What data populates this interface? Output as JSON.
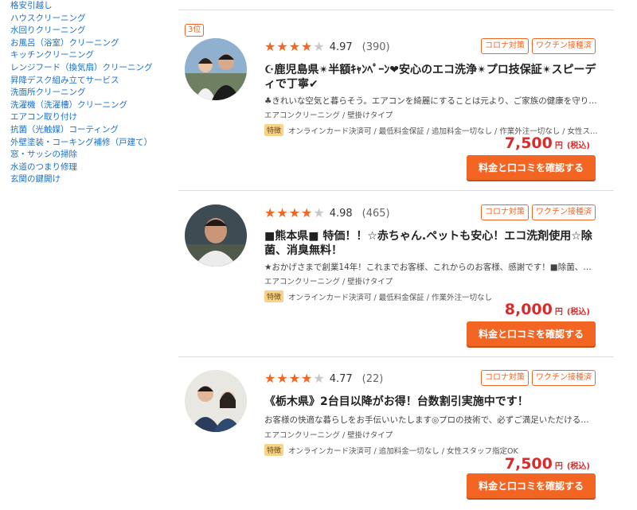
{
  "sidebar": {
    "links": [
      "格安引越し",
      "ハウスクリーニング",
      "水回りクリーニング",
      "お風呂（浴室）クリーニング",
      "キッチンクリーニング",
      "レンジフード（換気扇）クリーニング",
      "昇降デスク組み立てサービス",
      "洗面所クリーニング",
      "洗濯機（洗濯槽）クリーニング",
      "エアコン取り付け",
      "抗菌（光触媒）コーティング",
      "外壁塗装・コーキング補修（戸建て）",
      "窓・サッシの掃除",
      "水道のつまり修理",
      "玄関の鍵開け"
    ]
  },
  "common": {
    "badge_covid": "コロナ対策",
    "badge_vaccine": "ワクチン接種済",
    "feature_tag": "特徴",
    "yen": "円",
    "tax": "(税込)",
    "cta_label": "料金と口コミを確認する"
  },
  "listings": [
    {
      "rank": "3位",
      "stars": 4,
      "score": "4.97",
      "count": "(390)",
      "title": "☪鹿児島県✴半額ｷｬﾝﾍﾟｰﾝ❤安心のエコ洗浄✴プロ技保証✴スピーディで丁寧✔",
      "description": "♣きれいな空気と暮らそう。エアコンを綺麗にすることは元より、ご家族の健康を守り…",
      "category": "エアコンクリーニング / 壁掛けタイプ",
      "features": "オンラインカード決済可 / 最低料金保証 / 追加料金一切なし / 作業外注一切なし / 女性スタッ…",
      "price": "7,500"
    },
    {
      "rank": "",
      "stars": 4,
      "score": "4.98",
      "count": "(465)",
      "title": "■熊本県■ 特価！！☆赤ちゃん.ペットも安心！エコ洗剤使用☆除菌、消臭無料！",
      "description": "★おかげさまで創業14年！これまでお客様、これからのお客様、感謝です！■除菌、…",
      "category": "エアコンクリーニング / 壁掛けタイプ",
      "features": "オンラインカード決済可 / 最低料金保証 / 作業外注一切なし",
      "price": "8,000"
    },
    {
      "rank": "",
      "stars": 4,
      "score": "4.77",
      "count": "(22)",
      "title": "《栃木県》2台目以降がお得！台数割引実施中です！",
      "description": "お客様の快適な暮らしをお手伝いいたします◎プロの技術で、必ずご満足いただける…",
      "category": "エアコンクリーニング / 壁掛けタイプ",
      "features": "オンラインカード決済可 / 追加料金一切なし / 女性スタッフ指定OK",
      "price": "7,500"
    }
  ],
  "colors": {
    "accent": "#f26522",
    "price": "#d92b2b",
    "link": "#1a6fc9"
  }
}
